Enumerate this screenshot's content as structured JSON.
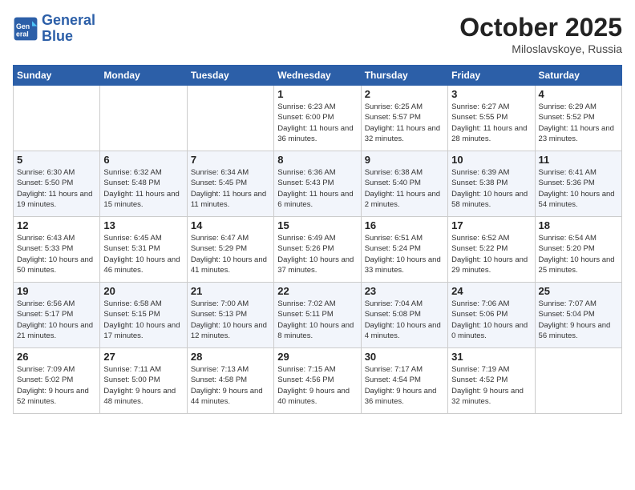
{
  "header": {
    "logo_line1": "General",
    "logo_line2": "Blue",
    "month": "October 2025",
    "location": "Miloslavskoye, Russia"
  },
  "days_of_week": [
    "Sunday",
    "Monday",
    "Tuesday",
    "Wednesday",
    "Thursday",
    "Friday",
    "Saturday"
  ],
  "weeks": [
    {
      "alt": false,
      "days": [
        {
          "num": "",
          "info": ""
        },
        {
          "num": "",
          "info": ""
        },
        {
          "num": "",
          "info": ""
        },
        {
          "num": "1",
          "info": "Sunrise: 6:23 AM\nSunset: 6:00 PM\nDaylight: 11 hours\nand 36 minutes."
        },
        {
          "num": "2",
          "info": "Sunrise: 6:25 AM\nSunset: 5:57 PM\nDaylight: 11 hours\nand 32 minutes."
        },
        {
          "num": "3",
          "info": "Sunrise: 6:27 AM\nSunset: 5:55 PM\nDaylight: 11 hours\nand 28 minutes."
        },
        {
          "num": "4",
          "info": "Sunrise: 6:29 AM\nSunset: 5:52 PM\nDaylight: 11 hours\nand 23 minutes."
        }
      ]
    },
    {
      "alt": true,
      "days": [
        {
          "num": "5",
          "info": "Sunrise: 6:30 AM\nSunset: 5:50 PM\nDaylight: 11 hours\nand 19 minutes."
        },
        {
          "num": "6",
          "info": "Sunrise: 6:32 AM\nSunset: 5:48 PM\nDaylight: 11 hours\nand 15 minutes."
        },
        {
          "num": "7",
          "info": "Sunrise: 6:34 AM\nSunset: 5:45 PM\nDaylight: 11 hours\nand 11 minutes."
        },
        {
          "num": "8",
          "info": "Sunrise: 6:36 AM\nSunset: 5:43 PM\nDaylight: 11 hours\nand 6 minutes."
        },
        {
          "num": "9",
          "info": "Sunrise: 6:38 AM\nSunset: 5:40 PM\nDaylight: 11 hours\nand 2 minutes."
        },
        {
          "num": "10",
          "info": "Sunrise: 6:39 AM\nSunset: 5:38 PM\nDaylight: 10 hours\nand 58 minutes."
        },
        {
          "num": "11",
          "info": "Sunrise: 6:41 AM\nSunset: 5:36 PM\nDaylight: 10 hours\nand 54 minutes."
        }
      ]
    },
    {
      "alt": false,
      "days": [
        {
          "num": "12",
          "info": "Sunrise: 6:43 AM\nSunset: 5:33 PM\nDaylight: 10 hours\nand 50 minutes."
        },
        {
          "num": "13",
          "info": "Sunrise: 6:45 AM\nSunset: 5:31 PM\nDaylight: 10 hours\nand 46 minutes."
        },
        {
          "num": "14",
          "info": "Sunrise: 6:47 AM\nSunset: 5:29 PM\nDaylight: 10 hours\nand 41 minutes."
        },
        {
          "num": "15",
          "info": "Sunrise: 6:49 AM\nSunset: 5:26 PM\nDaylight: 10 hours\nand 37 minutes."
        },
        {
          "num": "16",
          "info": "Sunrise: 6:51 AM\nSunset: 5:24 PM\nDaylight: 10 hours\nand 33 minutes."
        },
        {
          "num": "17",
          "info": "Sunrise: 6:52 AM\nSunset: 5:22 PM\nDaylight: 10 hours\nand 29 minutes."
        },
        {
          "num": "18",
          "info": "Sunrise: 6:54 AM\nSunset: 5:20 PM\nDaylight: 10 hours\nand 25 minutes."
        }
      ]
    },
    {
      "alt": true,
      "days": [
        {
          "num": "19",
          "info": "Sunrise: 6:56 AM\nSunset: 5:17 PM\nDaylight: 10 hours\nand 21 minutes."
        },
        {
          "num": "20",
          "info": "Sunrise: 6:58 AM\nSunset: 5:15 PM\nDaylight: 10 hours\nand 17 minutes."
        },
        {
          "num": "21",
          "info": "Sunrise: 7:00 AM\nSunset: 5:13 PM\nDaylight: 10 hours\nand 12 minutes."
        },
        {
          "num": "22",
          "info": "Sunrise: 7:02 AM\nSunset: 5:11 PM\nDaylight: 10 hours\nand 8 minutes."
        },
        {
          "num": "23",
          "info": "Sunrise: 7:04 AM\nSunset: 5:08 PM\nDaylight: 10 hours\nand 4 minutes."
        },
        {
          "num": "24",
          "info": "Sunrise: 7:06 AM\nSunset: 5:06 PM\nDaylight: 10 hours\nand 0 minutes."
        },
        {
          "num": "25",
          "info": "Sunrise: 7:07 AM\nSunset: 5:04 PM\nDaylight: 9 hours\nand 56 minutes."
        }
      ]
    },
    {
      "alt": false,
      "days": [
        {
          "num": "26",
          "info": "Sunrise: 7:09 AM\nSunset: 5:02 PM\nDaylight: 9 hours\nand 52 minutes."
        },
        {
          "num": "27",
          "info": "Sunrise: 7:11 AM\nSunset: 5:00 PM\nDaylight: 9 hours\nand 48 minutes."
        },
        {
          "num": "28",
          "info": "Sunrise: 7:13 AM\nSunset: 4:58 PM\nDaylight: 9 hours\nand 44 minutes."
        },
        {
          "num": "29",
          "info": "Sunrise: 7:15 AM\nSunset: 4:56 PM\nDaylight: 9 hours\nand 40 minutes."
        },
        {
          "num": "30",
          "info": "Sunrise: 7:17 AM\nSunset: 4:54 PM\nDaylight: 9 hours\nand 36 minutes."
        },
        {
          "num": "31",
          "info": "Sunrise: 7:19 AM\nSunset: 4:52 PM\nDaylight: 9 hours\nand 32 minutes."
        },
        {
          "num": "",
          "info": ""
        }
      ]
    }
  ]
}
